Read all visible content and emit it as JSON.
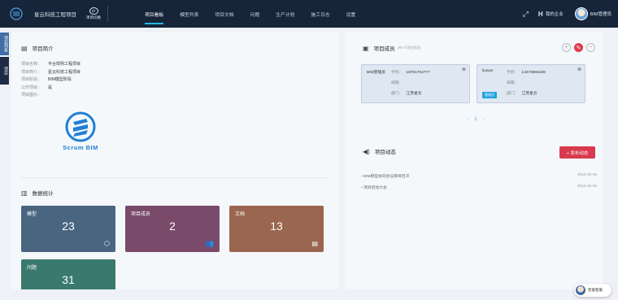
{
  "header": {
    "project_name": "星云科技工程项目",
    "switch_label": "项目切换",
    "nav": [
      "项目看板",
      "模型列表",
      "项目文档",
      "问题",
      "生产计划",
      "施工日志",
      "设置"
    ],
    "company_label": "我的企业",
    "user_name": "BIM管理员"
  },
  "side_tabs": [
    "项目列表",
    "项目"
  ],
  "intro": {
    "title": "项目简介",
    "rows": [
      {
        "k": "项目名称：",
        "v": "平台样例工程项目"
      },
      {
        "k": "项目简介：",
        "v": "星云科技工程项目"
      },
      {
        "k": "项目阶段：",
        "v": "BIM模型阶段"
      },
      {
        "k": "公开项目：",
        "v": "是"
      },
      {
        "k": "项目图片：",
        "v": ""
      }
    ],
    "brand": "Scrum BIM"
  },
  "stats": {
    "title": "数据统计",
    "cards": [
      {
        "label": "模型",
        "value": "23"
      },
      {
        "label": "项目成员",
        "value": "2"
      },
      {
        "label": "文档",
        "value": "13"
      },
      {
        "label": "问题",
        "value": "31"
      }
    ]
  },
  "members": {
    "title": "项目成员",
    "hint": "(共3个项目成员)",
    "cards": [
      {
        "name": "BIM管理员",
        "phone_k": "手机：",
        "phone": "18781764777",
        "email_k": "邮箱：",
        "email": "",
        "dept_k": "部门：",
        "dept": "江苏星云",
        "tag": ""
      },
      {
        "name": "liuwan",
        "phone_k": "手机：",
        "phone": "13270866188",
        "email_k": "邮箱：",
        "email": "",
        "dept_k": "部门：",
        "dept": "江苏星云",
        "tag": "管理员"
      }
    ],
    "page": "1"
  },
  "news": {
    "title": "项目动态",
    "publish_label": "+ 发布动态",
    "items": [
      {
        "title": "BIM模型协同会议即将召开",
        "date": "2019 05 05"
      },
      {
        "title": "项目启动大会",
        "date": "2019 05 05"
      }
    ]
  },
  "helper": {
    "label": "智能客服"
  }
}
